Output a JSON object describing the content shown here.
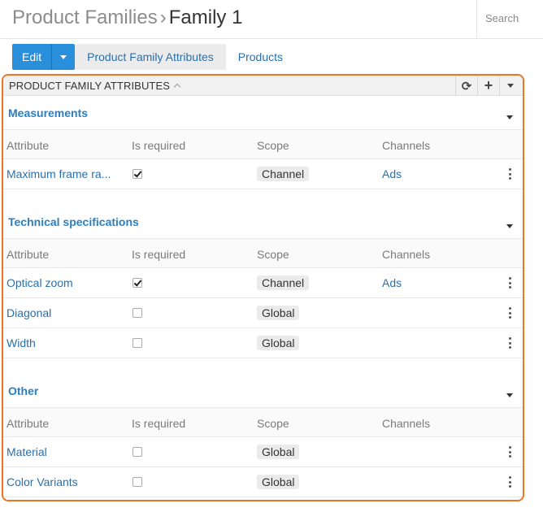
{
  "header": {
    "parent_crumb": "Product Families",
    "separator": "›",
    "current_crumb": "Family 1",
    "search_placeholder": "Search"
  },
  "toolbar": {
    "edit_label": "Edit",
    "tabs": [
      {
        "label": "Product Family Attributes",
        "active": true
      },
      {
        "label": "Products",
        "active": false
      }
    ]
  },
  "panel": {
    "title": "PRODUCT FAMILY ATTRIBUTES",
    "refresh_icon": "⟳",
    "add_icon": "+",
    "columns": [
      "Attribute",
      "Is required",
      "Scope",
      "Channels"
    ],
    "groups": [
      {
        "title": "Measurements",
        "rows": [
          {
            "attribute": "Maximum frame ra...",
            "required": true,
            "scope": "Channel",
            "channels": "Ads"
          }
        ]
      },
      {
        "title": "Technical specifications",
        "rows": [
          {
            "attribute": "Optical zoom",
            "required": true,
            "scope": "Channel",
            "channels": "Ads"
          },
          {
            "attribute": "Diagonal",
            "required": false,
            "scope": "Global",
            "channels": ""
          },
          {
            "attribute": "Width",
            "required": false,
            "scope": "Global",
            "channels": ""
          }
        ]
      },
      {
        "title": "Other",
        "rows": [
          {
            "attribute": "Material",
            "required": false,
            "scope": "Global",
            "channels": ""
          },
          {
            "attribute": "Color Variants",
            "required": false,
            "scope": "Global",
            "channels": ""
          }
        ]
      }
    ]
  },
  "colors": {
    "accent": "#2a8fdb",
    "link": "#2a6fad",
    "highlight_border": "#ec7424"
  }
}
